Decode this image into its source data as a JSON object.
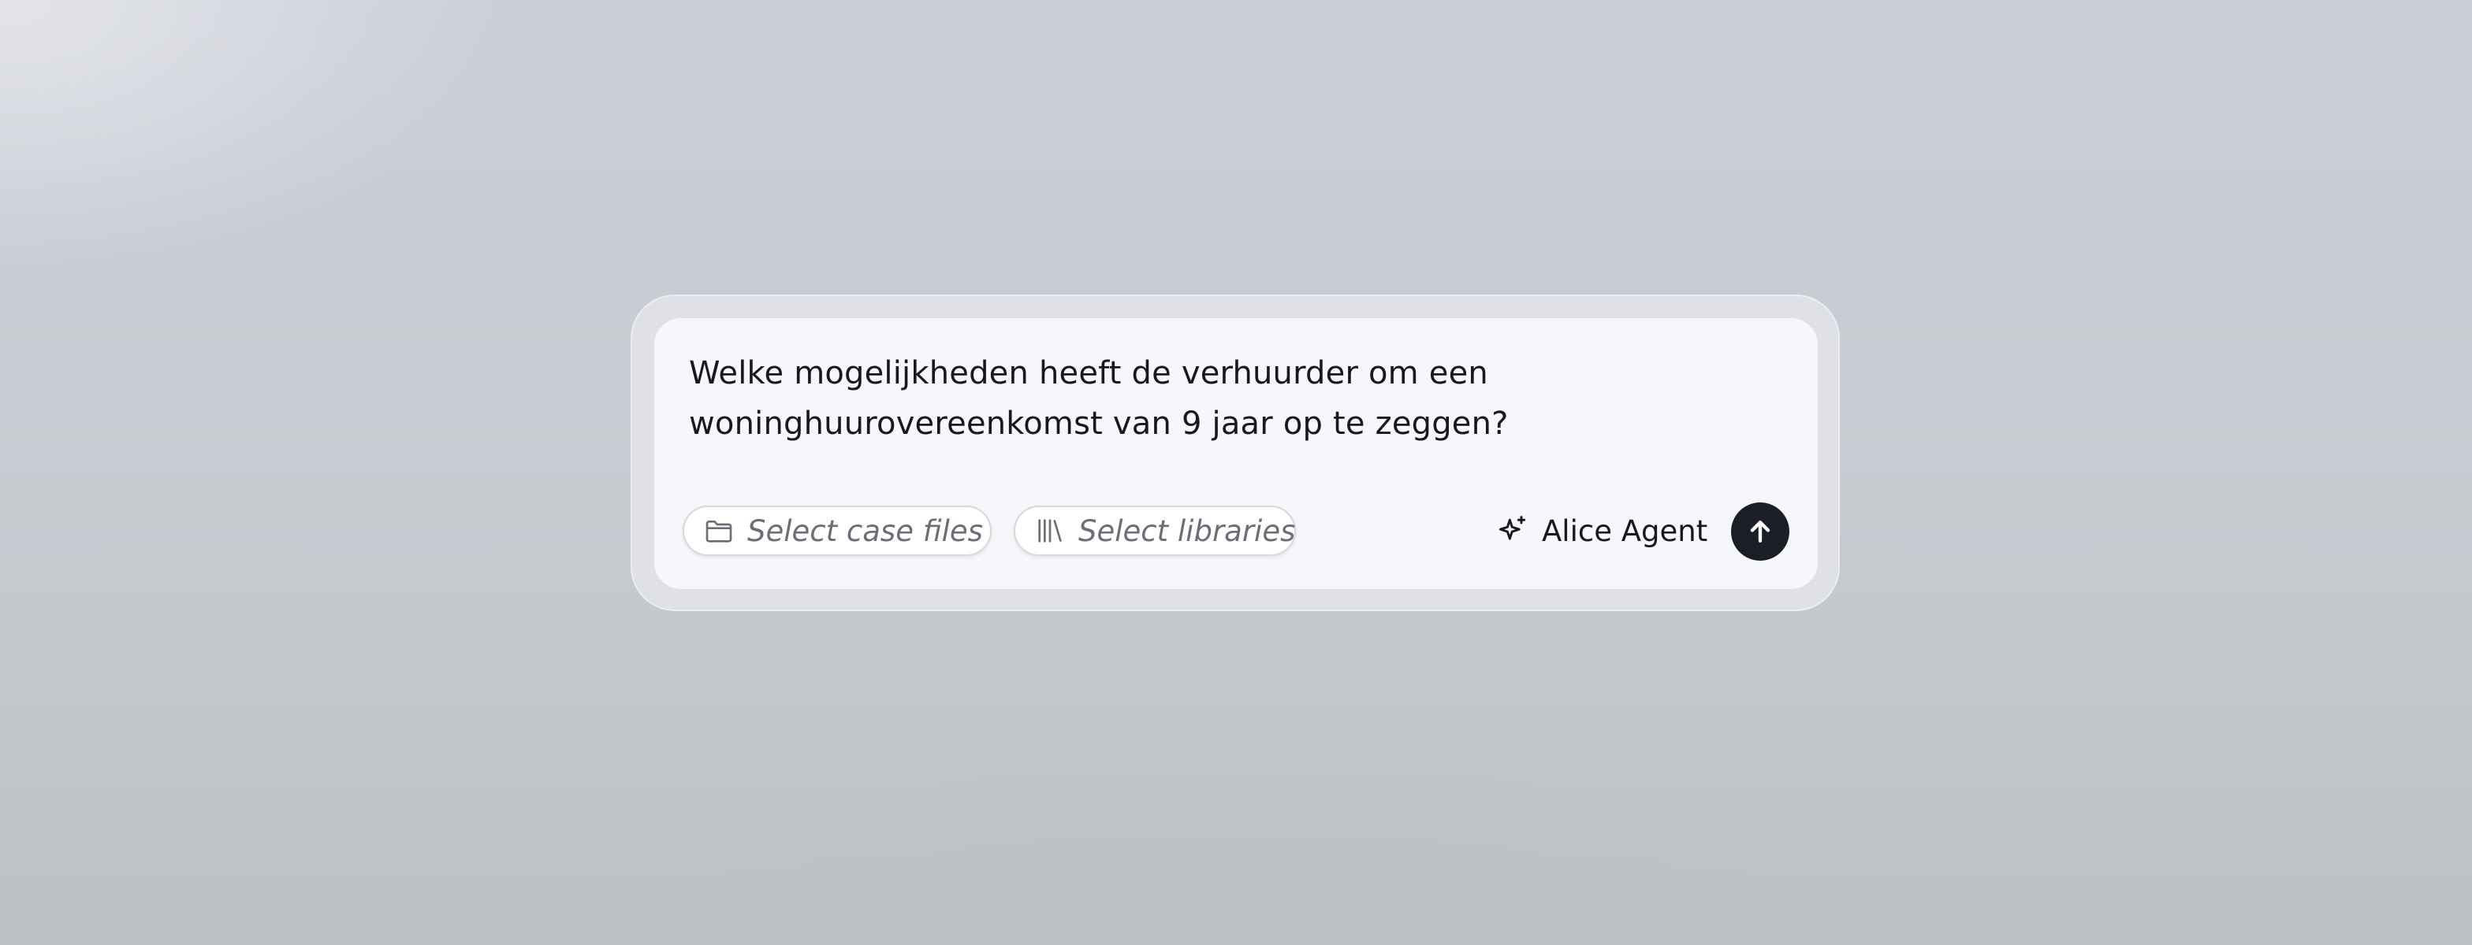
{
  "composer": {
    "query": "Welke mogelijkheden heeft de verhuurder om een woninghuurovereenkomst van 9 jaar op te zeggen?",
    "case_files_chip": {
      "label": "Select case files",
      "icon": "folder-icon"
    },
    "libraries_chip": {
      "label": "Select libraries",
      "icon": "library-icon"
    },
    "agent": {
      "label": "Alice Agent",
      "icon": "sparkle-icon"
    },
    "send": {
      "icon": "arrow-up-icon"
    }
  },
  "colors": {
    "send_button": "#1b1e27",
    "text": "#17191f",
    "chip_text": "#6b6e76",
    "composer_bg": "#f6f7fb"
  }
}
